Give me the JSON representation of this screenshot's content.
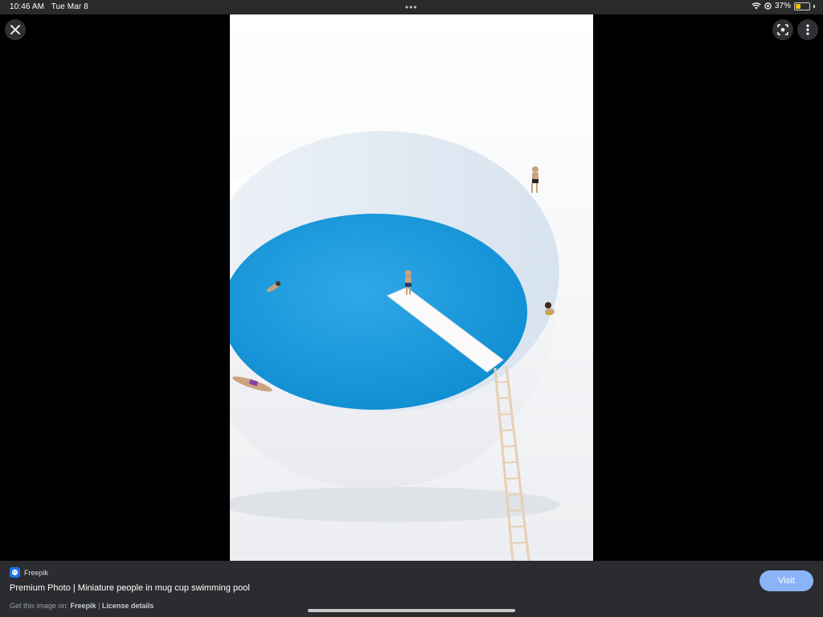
{
  "status": {
    "time": "10:46 AM",
    "date": "Tue Mar 8",
    "multitask": "•••",
    "battery_percent": "37%",
    "battery_level": 0.37,
    "battery_color": "#f2c200",
    "icons": [
      "wifi-icon",
      "location-icon",
      "battery-icon"
    ]
  },
  "viewer": {
    "close_icon": "close-icon",
    "lens_icon": "lens-icon",
    "more_icon": "more-vert-icon"
  },
  "result": {
    "source": "Freepik",
    "title": "Premium Photo | Miniature people in mug cup swimming pool",
    "credit_prefix": "Get this image on: ",
    "credit_source": "Freepik",
    "credit_separator": " | ",
    "license_link": "License details",
    "visit_label": "Visit",
    "accent": "#8ab4f8"
  }
}
